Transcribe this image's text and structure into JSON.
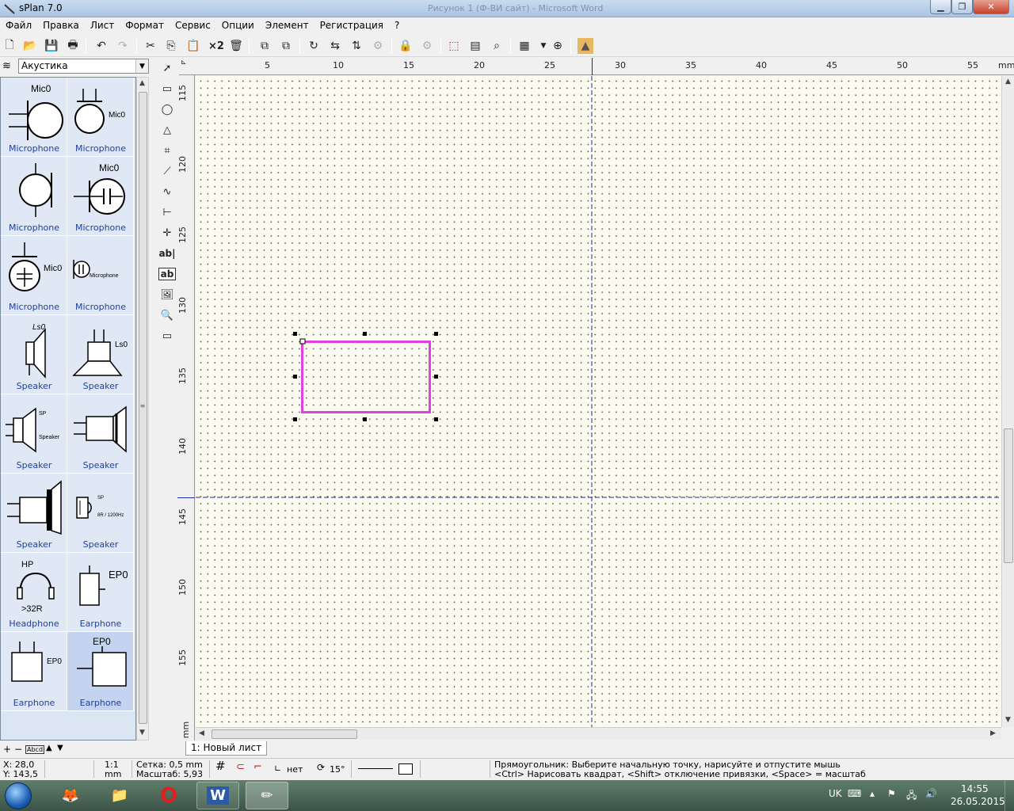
{
  "window": {
    "title": "sPlan 7.0",
    "faded_title": "Рисунок 1 (Ф-ВИ сайт) - Microsoft Word"
  },
  "menu": [
    "Файл",
    "Правка",
    "Лист",
    "Формат",
    "Сервис",
    "Опции",
    "Элемент",
    "Регистрация",
    "?"
  ],
  "toolbar": {
    "multiply_label": "×2"
  },
  "library": {
    "selected": "Акустика",
    "items": [
      {
        "label": "Microphone",
        "caption": "Mic0",
        "icon": "mic-circle-left-icon"
      },
      {
        "label": "Microphone",
        "caption": "Mic0",
        "icon": "mic-circle-right-icon"
      },
      {
        "label": "Microphone",
        "caption": "",
        "icon": "mic-circle-bar-icon"
      },
      {
        "label": "Microphone",
        "caption": "Mic0",
        "icon": "mic-circle-capacitor-icon"
      },
      {
        "label": "Microphone",
        "caption": "Mic0",
        "icon": "mic-small-capacitor-icon"
      },
      {
        "label": "Microphone",
        "caption": "Microphone",
        "icon": "mic-tiny-icon"
      },
      {
        "label": "Speaker",
        "caption": "Ls0",
        "icon": "speaker-vertical-icon"
      },
      {
        "label": "Speaker",
        "caption": "Ls0",
        "icon": "speaker-horn-icon"
      },
      {
        "label": "Speaker",
        "caption": "SP",
        "caption2": "Speaker",
        "icon": "speaker-polar-icon"
      },
      {
        "label": "Speaker",
        "caption": "",
        "icon": "speaker-box-icon"
      },
      {
        "label": "Speaker",
        "caption": "",
        "icon": "speaker-thick-icon"
      },
      {
        "label": "Speaker",
        "caption": "SP",
        "caption2": "8R / 1200Hz",
        "icon": "buzzer-icon"
      },
      {
        "label": "Headphone",
        "caption": "HP",
        "caption2": ">32R",
        "icon": "headphone-icon"
      },
      {
        "label": "Earphone",
        "caption": "EP0",
        "icon": "earphone-box-icon"
      },
      {
        "label": "Earphone",
        "caption": "EP0",
        "icon": "earphone-small-icon"
      },
      {
        "label": "Earphone",
        "caption": "EP0",
        "icon": "earphone-large-icon"
      }
    ]
  },
  "ruler": {
    "top": [
      "5",
      "10",
      "15",
      "20",
      "25",
      "30",
      "35",
      "40",
      "45",
      "50",
      "55"
    ],
    "top_unit": "mm",
    "left": [
      "115",
      "120",
      "125",
      "130",
      "135",
      "140",
      "145",
      "150",
      "155"
    ],
    "left_unit": "mm"
  },
  "sheet_tab": "1: Новый лист",
  "status": {
    "x": "X: 28,0",
    "y": "Y: 143,5",
    "scale_ratio": "1:1",
    "scale_unit": "mm",
    "grid": "Сетка: 0,5 mm",
    "zoom": "Масштаб:  5,93",
    "angle_mode": "нет",
    "rotation": "15°",
    "hint1": "Прямоугольник: Выберите начальную точку, нарисуйте и отпустите мышь",
    "hint2": "<Ctrl> Нарисовать квадрат, <Shift> отключение привязки, <Space> = масштаб"
  },
  "taskbar": {
    "lang": "UK",
    "time": "14:55",
    "date": "26.05.2015"
  },
  "colors": {
    "selection": "#e040e0",
    "crosshair": "#1e2aa0",
    "library_label": "#1f3fa0"
  }
}
